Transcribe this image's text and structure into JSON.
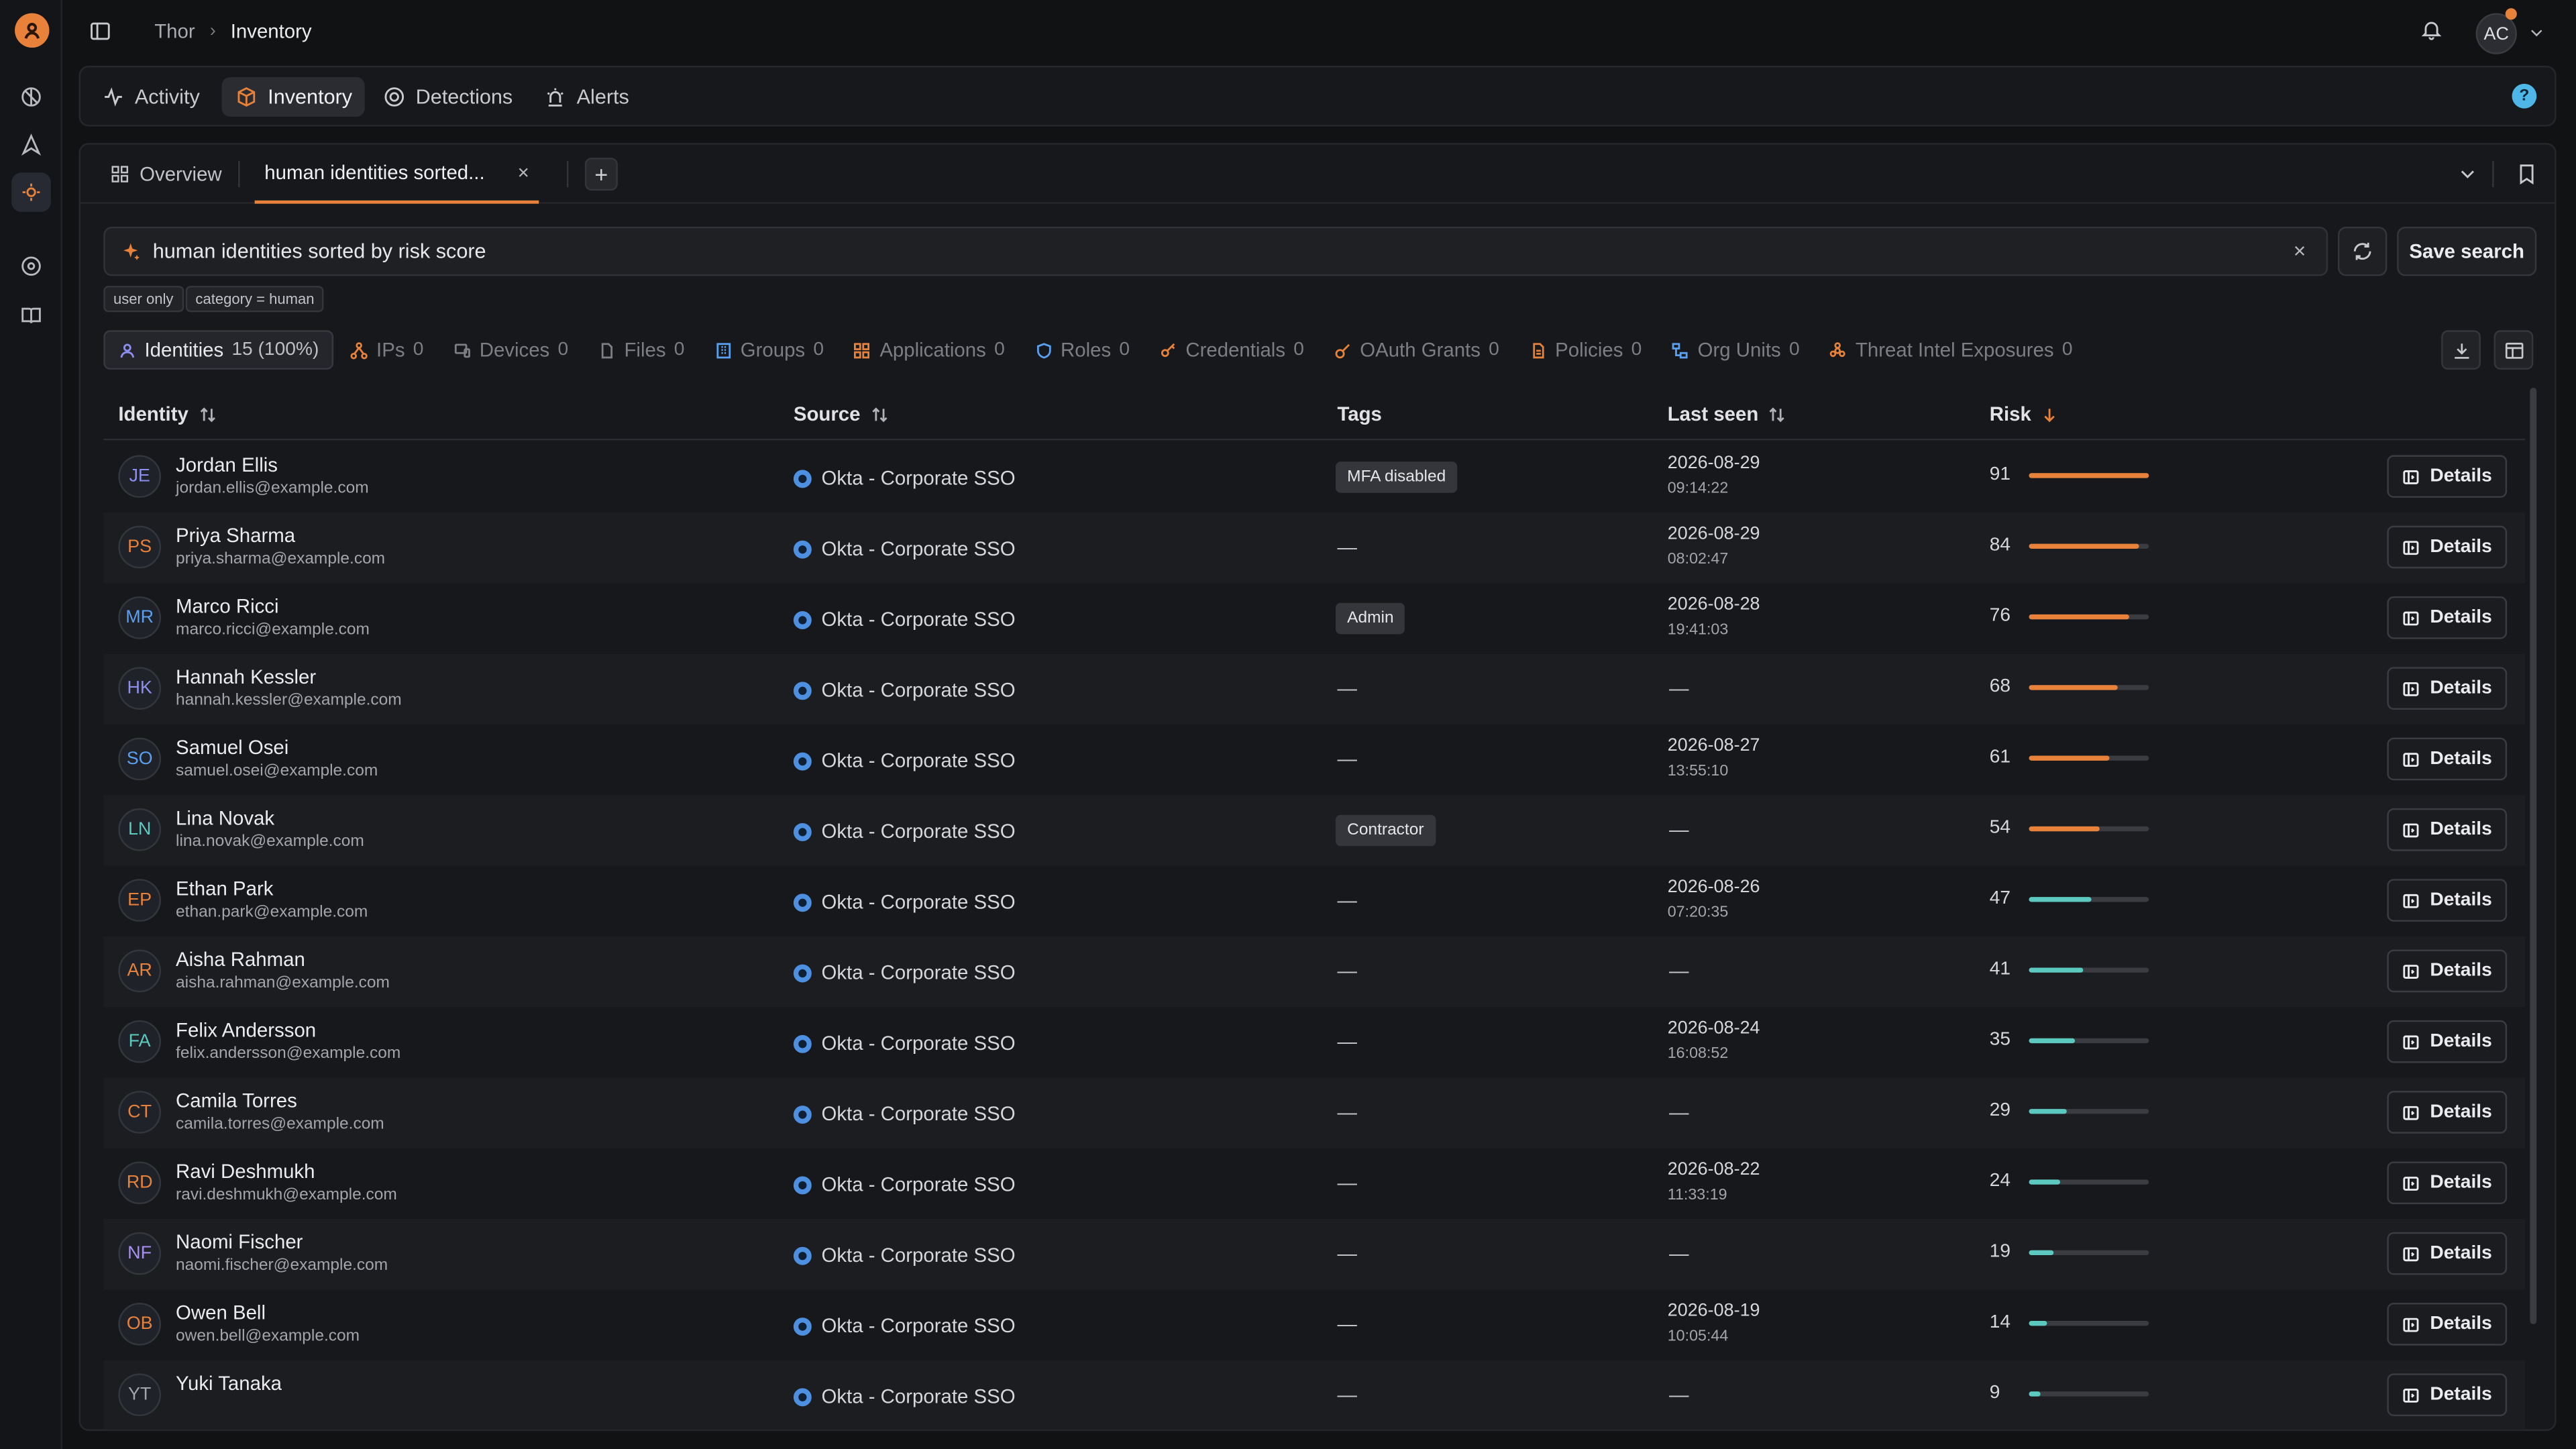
{
  "breadcrumb": {
    "root": "Thor",
    "current": "Inventory"
  },
  "user": {
    "initials": "AC"
  },
  "nav": {
    "tabs": [
      {
        "label": "Activity",
        "icon": "activity-icon"
      },
      {
        "label": "Inventory",
        "icon": "box-icon"
      },
      {
        "label": "Detections",
        "icon": "target-icon"
      },
      {
        "label": "Alerts",
        "icon": "siren-icon"
      }
    ],
    "help": "?"
  },
  "subtabs": {
    "overview": "Overview",
    "query": "human identities sorted...",
    "close": "×",
    "add": "+"
  },
  "search": {
    "value": "human identities sorted by risk score",
    "clear": "×",
    "save_label": "Save search"
  },
  "chips": [
    "user only",
    "category = human"
  ],
  "categories": [
    {
      "label": "Identities",
      "count": "15 (100%)"
    },
    {
      "label": "IPs",
      "count": "0"
    },
    {
      "label": "Devices",
      "count": "0"
    },
    {
      "label": "Files",
      "count": "0"
    },
    {
      "label": "Groups",
      "count": "0"
    },
    {
      "label": "Applications",
      "count": "0"
    },
    {
      "label": "Roles",
      "count": "0"
    },
    {
      "label": "Credentials",
      "count": "0"
    },
    {
      "label": "OAuth Grants",
      "count": "0"
    },
    {
      "label": "Policies",
      "count": "0"
    },
    {
      "label": "Org Units",
      "count": "0"
    },
    {
      "label": "Threat Intel Exposures",
      "count": "0"
    }
  ],
  "table": {
    "headers": {
      "identity": "Identity",
      "source": "Source",
      "tags": "Tags",
      "last_seen": "Last seen",
      "risk": "Risk"
    },
    "details_label": "Details",
    "rows": [
      {
        "initials": "JE",
        "name": "Jordan Ellis",
        "email": "jordan.ellis@example.com",
        "source": "Okta - Corporate SSO",
        "tag": "MFA disabled",
        "date": "2026-08-29",
        "time": "09:14:22",
        "risk": "91"
      },
      {
        "initials": "PS",
        "name": "Priya Sharma",
        "email": "priya.sharma@example.com",
        "source": "Okta - Corporate SSO",
        "tag": "—",
        "date": "2026-08-29",
        "time": "08:02:47",
        "risk": "84"
      },
      {
        "initials": "MR",
        "name": "Marco Ricci",
        "email": "marco.ricci@example.com",
        "source": "Okta - Corporate SSO",
        "tag": "Admin",
        "date": "2026-08-28",
        "time": "19:41:03",
        "risk": "76"
      },
      {
        "initials": "HK",
        "name": "Hannah Kessler",
        "email": "hannah.kessler@example.com",
        "source": "Okta - Corporate SSO",
        "tag": "—",
        "date": "—",
        "time": "",
        "risk": "68"
      },
      {
        "initials": "SO",
        "name": "Samuel Osei",
        "email": "samuel.osei@example.com",
        "source": "Okta - Corporate SSO",
        "tag": "—",
        "date": "2026-08-27",
        "time": "13:55:10",
        "risk": "61"
      },
      {
        "initials": "LN",
        "name": "Lina Novak",
        "email": "lina.novak@example.com",
        "source": "Okta - Corporate SSO",
        "tag": "Contractor",
        "date": "—",
        "time": "",
        "risk": "54"
      },
      {
        "initials": "EP",
        "name": "Ethan Park",
        "email": "ethan.park@example.com",
        "source": "Okta - Corporate SSO",
        "tag": "—",
        "date": "2026-08-26",
        "time": "07:20:35",
        "risk": "47"
      },
      {
        "initials": "AR",
        "name": "Aisha Rahman",
        "email": "aisha.rahman@example.com",
        "source": "Okta - Corporate SSO",
        "tag": "—",
        "date": "—",
        "time": "",
        "risk": "41"
      },
      {
        "initials": "FA",
        "name": "Felix Andersson",
        "email": "felix.andersson@example.com",
        "source": "Okta - Corporate SSO",
        "tag": "—",
        "date": "2026-08-24",
        "time": "16:08:52",
        "risk": "35"
      },
      {
        "initials": "CT",
        "name": "Camila Torres",
        "email": "camila.torres@example.com",
        "source": "Okta - Corporate SSO",
        "tag": "—",
        "date": "—",
        "time": "",
        "risk": "29"
      },
      {
        "initials": "RD",
        "name": "Ravi Deshmukh",
        "email": "ravi.deshmukh@example.com",
        "source": "Okta - Corporate SSO",
        "tag": "—",
        "date": "2026-08-22",
        "time": "11:33:19",
        "risk": "24"
      },
      {
        "initials": "NF",
        "name": "Naomi Fischer",
        "email": "naomi.fischer@example.com",
        "source": "Okta - Corporate SSO",
        "tag": "—",
        "date": "—",
        "time": "",
        "risk": "19"
      },
      {
        "initials": "OB",
        "name": "Owen Bell",
        "email": "owen.bell@example.com",
        "source": "Okta - Corporate SSO",
        "tag": "—",
        "date": "2026-08-19",
        "time": "10:05:44",
        "risk": "14"
      },
      {
        "initials": "YT",
        "name": "Yuki Tanaka",
        "email": "",
        "source": "Okta - Corporate SSO",
        "tag": "—",
        "date": "—",
        "time": "",
        "risk": "9"
      }
    ]
  },
  "colors": {
    "accent": "#e8823a",
    "risk_high": "#e8823a",
    "risk_low": "#5cc9c0",
    "avatar_palette": [
      "#8c8ff0",
      "#e8823a",
      "#5aa0f0",
      "#8c8ff0",
      "#5aa0f0",
      "#5cc9c0",
      "#e8823a",
      "#e8823a",
      "#5cc9c0",
      "#e8823a",
      "#e8823a",
      "#a98ff0",
      "#e8823a",
      "#a4a5aa"
    ]
  }
}
